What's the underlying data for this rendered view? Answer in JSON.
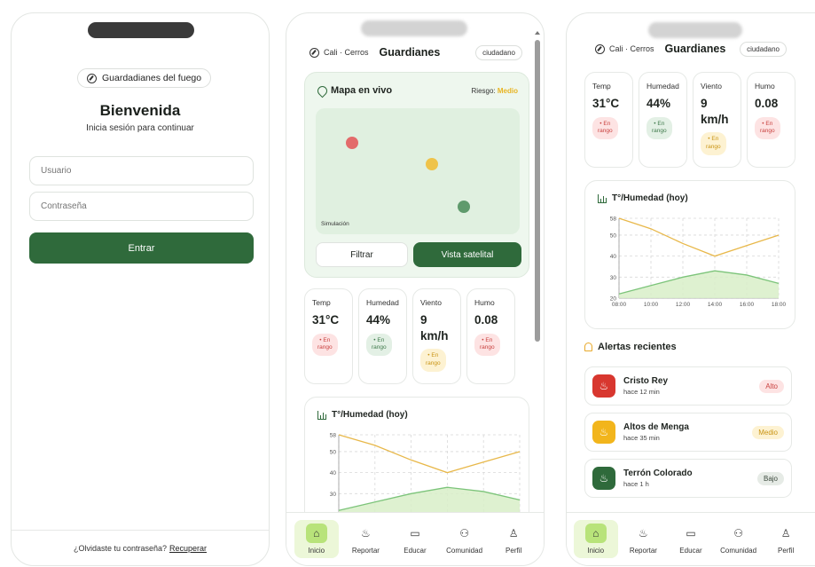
{
  "login": {
    "brand": "Guardadianes del fuego",
    "title": "Bienvenida",
    "subtitle": "Inicia sesión para continuar",
    "username_placeholder": "Usuario",
    "password_placeholder": "Contraseña",
    "submit_label": "Entrar",
    "forgot_text": "¿Olvidaste tu contraseña?",
    "recover_link": "Recuperar"
  },
  "header": {
    "location": "Cali · Cerros",
    "title": "Guardianes",
    "role": "ciudadano"
  },
  "map": {
    "title": "Mapa en vivo",
    "risk_label": "Riesgo:",
    "risk_value": "Medio",
    "simulation_label": "Simulación",
    "filter_button": "Filtrar",
    "satellite_button": "Vista satelital"
  },
  "stats": [
    {
      "label": "Temp",
      "value": "31°C",
      "chip_line1": "• En",
      "chip_line2": "rango",
      "status": "red"
    },
    {
      "label": "Humedad",
      "value": "44%",
      "chip_line1": "• En",
      "chip_line2": "rango",
      "status": "green"
    },
    {
      "label": "Viento",
      "value_line1": "9",
      "value_line2": "km/h",
      "chip_line1": "• En",
      "chip_line2": "rango",
      "status": "yellow"
    },
    {
      "label": "Humo",
      "value": "0.08",
      "chip_line1": "• En",
      "chip_line2": "rango",
      "status": "red"
    }
  ],
  "chart_data": {
    "type": "line",
    "title": "T°/Humedad (hoy)",
    "x": [
      "08:00",
      "10:00",
      "12:00",
      "14:00",
      "16:00",
      "18:00"
    ],
    "series": [
      {
        "values": [
          58,
          53,
          46,
          40,
          45,
          50
        ],
        "color": "#e8b84a"
      },
      {
        "values": [
          22,
          26,
          30,
          33,
          31,
          27
        ],
        "color": "#7cc47a",
        "fill": "#d8efc8"
      }
    ],
    "yticks": [
      20,
      30,
      40,
      50,
      58
    ],
    "ylim": [
      20,
      58
    ],
    "grid": true
  },
  "alerts": {
    "title": "Alertas recientes",
    "items": [
      {
        "name": "Cristo Rey",
        "time": "hace 12 min",
        "level": "Alto",
        "color": "#d8372f",
        "badge_bg": "#fde3e3",
        "badge_fg": "#c9413f"
      },
      {
        "name": "Altos de Menga",
        "time": "hace 35 min",
        "level": "Medio",
        "color": "#f2b51c",
        "badge_bg": "#fdf2d2",
        "badge_fg": "#c99414"
      },
      {
        "name": "Terrón Colorado",
        "time": "hace 1 h",
        "level": "Bajo",
        "color": "#2f6a3b",
        "badge_bg": "#e6ebe6",
        "badge_fg": "#3c4a3e"
      }
    ]
  },
  "nav": [
    {
      "label": "Inicio",
      "icon": "home-icon"
    },
    {
      "label": "Reportar",
      "icon": "flame-icon"
    },
    {
      "label": "Educar",
      "icon": "book-icon"
    },
    {
      "label": "Comunidad",
      "icon": "people-icon"
    },
    {
      "label": "Perfil",
      "icon": "user-icon"
    }
  ],
  "colors": {
    "primary": "#2f6a3b",
    "accent_lime": "#b8e37a",
    "risk_medium": "#e8b423"
  }
}
